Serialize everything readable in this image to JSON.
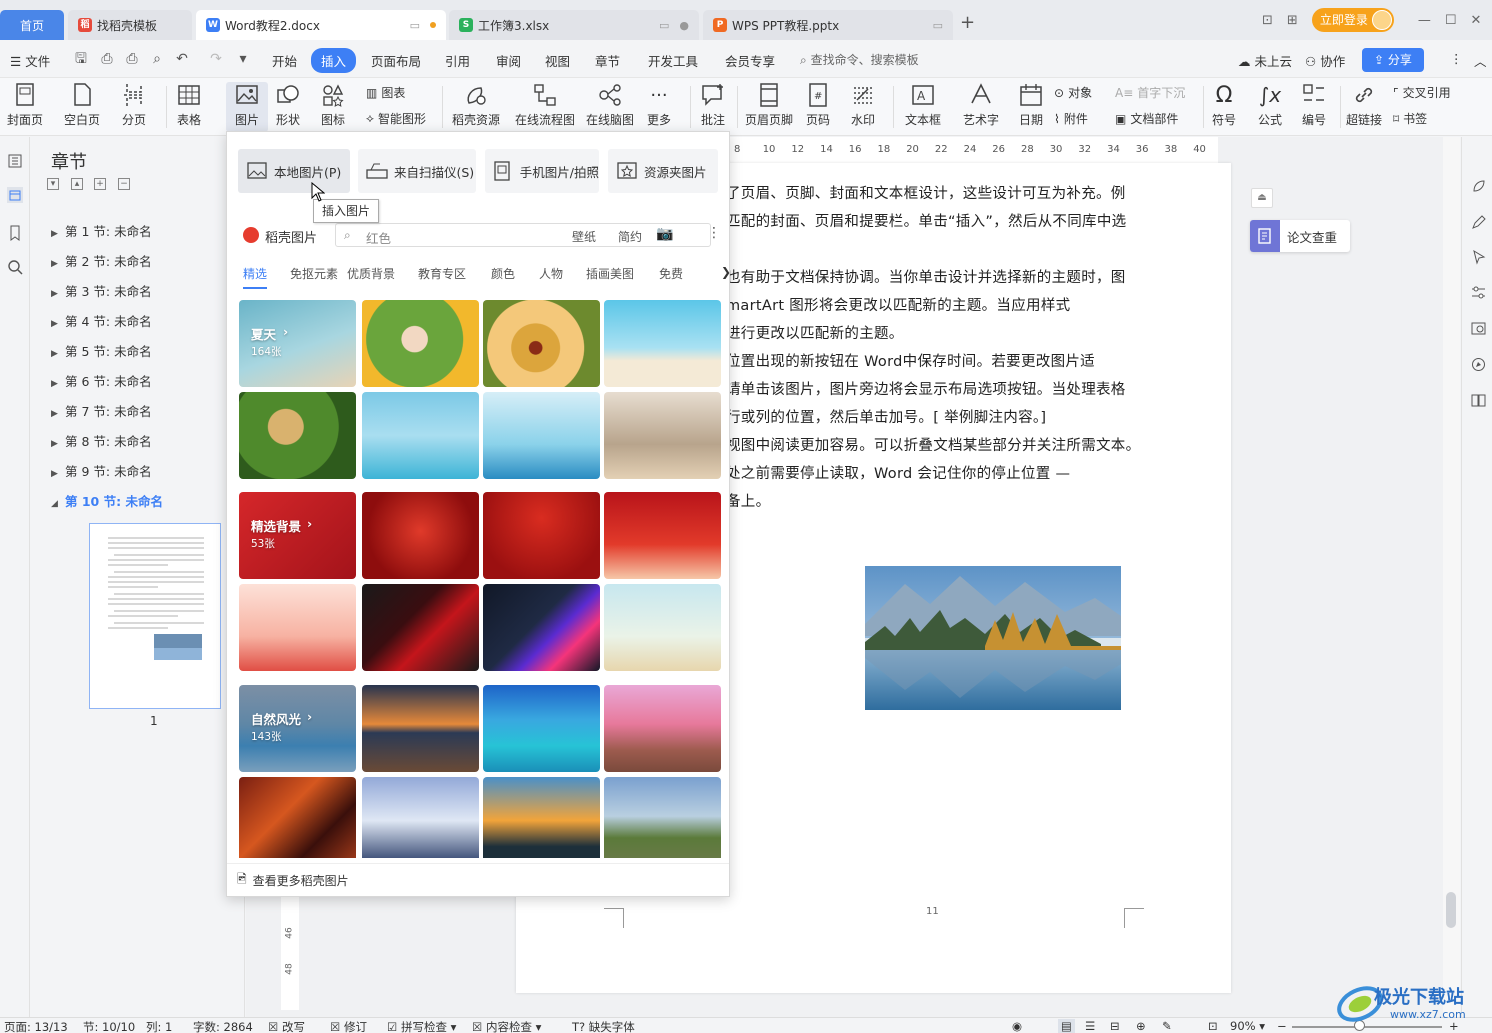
{
  "tabs": [
    {
      "label": "首页"
    },
    {
      "label": "找稻壳模板",
      "color": "#e64a3b"
    },
    {
      "label": "Word教程2.docx",
      "color": "#3d7ff5"
    },
    {
      "label": "工作簿3.xlsx",
      "color": "#2bb15c"
    },
    {
      "label": "WPS PPT教程.pptx",
      "color": "#f06a23"
    }
  ],
  "title_right": {
    "login": "立即登录"
  },
  "menu": {
    "file": "文件",
    "items": [
      "开始",
      "插入",
      "页面布局",
      "引用",
      "审阅",
      "视图",
      "章节",
      "开发工具",
      "会员专享"
    ],
    "active": "插入",
    "search": "查找命令、搜索模板",
    "cloud": "未上云",
    "collab": "协作",
    "share": "分享"
  },
  "ribbon": {
    "cover": "封面页",
    "blank": "空白页",
    "pagebreak": "分页",
    "table": "表格",
    "picture": "图片",
    "shape": "形状",
    "icon": "图标",
    "chart": "图表",
    "smartart": "智能图形",
    "docer": "稻壳资源",
    "flowchart": "在线流程图",
    "mindmap": "在线脑图",
    "more": "更多",
    "comment": "批注",
    "headerfooter": "页眉页脚",
    "pagenum": "页码",
    "watermark": "水印",
    "textbox": "文本框",
    "wordart": "艺术字",
    "date": "日期",
    "object": "对象",
    "attachment": "附件",
    "dropcap": "首字下沉",
    "docpart": "文档部件",
    "symbol": "符号",
    "formula": "公式",
    "numbering": "编号",
    "hyperlink": "超链接",
    "crossref": "交叉引用",
    "bookmark": "书签"
  },
  "chapter_panel": {
    "title": "章节",
    "sections": [
      "第 1 节: 未命名",
      "第 2 节: 未命名",
      "第 3 节: 未命名",
      "第 4 节: 未命名",
      "第 5 节: 未命名",
      "第 6 节: 未命名",
      "第 7 节: 未命名",
      "第 8 节: 未命名",
      "第 9 节: 未命名",
      "第 10 节: 未命名"
    ],
    "active_section": "第 10 节: 未命名",
    "page_label": "1"
  },
  "ruler": {
    "ticks": [
      "8",
      "10",
      "12",
      "14",
      "16",
      "18",
      "20",
      "22",
      "24",
      "26",
      "28",
      "30",
      "32",
      "34",
      "36",
      "38",
      "40"
    ]
  },
  "document": {
    "lines": [
      "了页眉、页脚、封面和文本框设计，这些设计可互为补充。例",
      "匹配的封面、页眉和提要栏。单击“插入”，然后从不同库中选",
      "也有助于文档保持协调。当你单击设计并选择新的主题时，图",
      "martArt 图形将会更改以匹配新的主题。当应用样式",
      "进行更改以匹配新的主题。",
      "位置出现的新按钮在 Word中保存时间。若要更改图片适",
      "请单击该图片，图片旁边将会显示布局选项按钮。当处理表格",
      "行或列的位置，然后单击加号。[ 举例脚注内容。]",
      "视图中阅读更加容易。可以折叠文档某些部分并关注所需文本。",
      "处之前需要停止读取，Word 会记住你的停止位置 —",
      "备上。"
    ],
    "page_number": "11"
  },
  "side_panel": {
    "thesis_check": "论文查重"
  },
  "picture_dropdown": {
    "sources": [
      "本地图片(P)",
      "来自扫描仪(S)",
      "手机图片/拍照",
      "资源夹图片"
    ],
    "tooltip": "插入图片",
    "docer_label": "稻壳图片",
    "search_value": "红色",
    "search_tags": [
      "壁纸",
      "简约"
    ],
    "categories": [
      "精选",
      "免抠元素",
      "优质背景",
      "教育专区",
      "颜色",
      "人物",
      "插画美图",
      "免费"
    ],
    "active_category": "精选",
    "groups": [
      {
        "title": "夏天",
        "count": "164张"
      },
      {
        "title": "精选背景",
        "count": "53张"
      },
      {
        "title": "自然风光",
        "count": "143张"
      }
    ],
    "more_link": "查看更多稻壳图片"
  },
  "status": {
    "page": "页面: 13/13",
    "section": "节: 10/10",
    "column": "列: 1",
    "wordcount": "字数: 2864",
    "revise": "改写",
    "track": "修订",
    "spellcheck": "拼写检查",
    "contentcheck": "内容检查",
    "missingfont": "缺失字体",
    "zoom": "90%"
  },
  "watermark": {
    "text": "极光下载站",
    "url": "www.xz7.com"
  },
  "colors": {
    "accent": "#3d7ff5",
    "login": "#f7a21b",
    "thesis": "#6f75d6"
  }
}
